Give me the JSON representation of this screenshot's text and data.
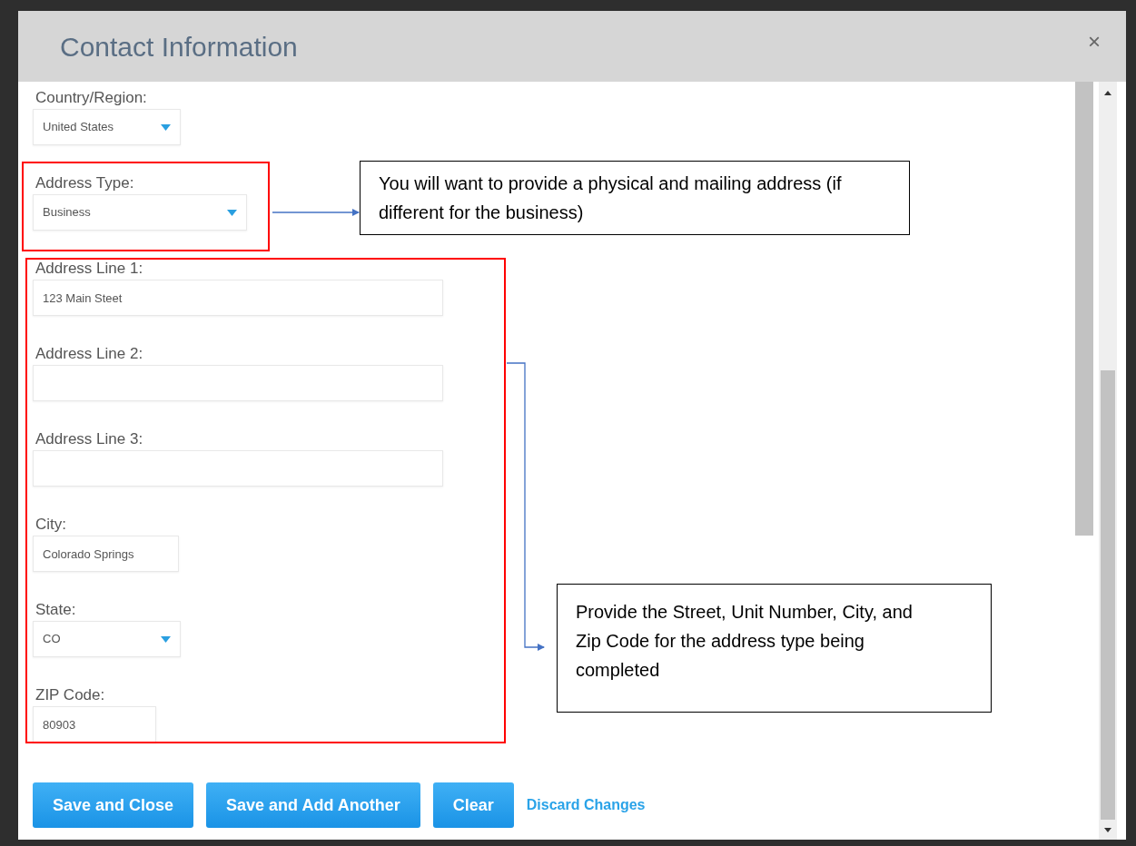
{
  "dialog": {
    "title": "Contact Information",
    "close": "×"
  },
  "fields": [
    {
      "kind": "select",
      "label": "Country/Region:",
      "value": "United States"
    },
    {
      "kind": "select",
      "label": "Address Type:",
      "value": "Business"
    },
    {
      "kind": "input",
      "label": "Address Line 1:",
      "value": "123 Main Steet"
    },
    {
      "kind": "input",
      "label": "Address Line 2:"
    },
    {
      "kind": "input",
      "label": "Address Line 3:"
    },
    {
      "kind": "input",
      "label": "City:",
      "value": "Colorado Springs"
    },
    {
      "kind": "select",
      "label": "State:",
      "value": "CO"
    },
    {
      "kind": "input",
      "label": "ZIP Code:",
      "value": "80903"
    }
  ],
  "buttons": [
    {
      "kind": "button",
      "label": "Save and Close"
    },
    {
      "kind": "button",
      "label": "Save and Add Another"
    },
    {
      "kind": "button",
      "label": "Clear"
    },
    {
      "kind": "link",
      "label": "Discard Changes"
    }
  ],
  "annotations": [
    {
      "text": "You will want to provide a physical and mailing address (if different for the business)"
    },
    {
      "text": "Provide the Street, Unit Number, City, and Zip Code for the address type being completed"
    }
  ]
}
